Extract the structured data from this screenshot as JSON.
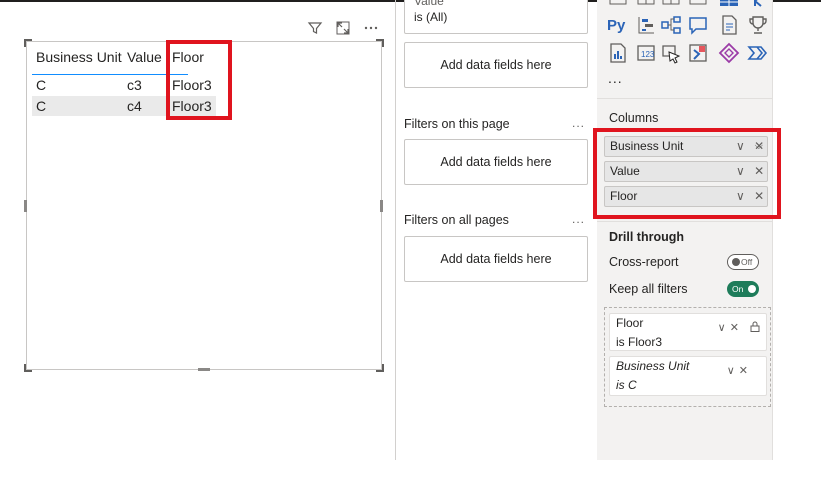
{
  "visual": {
    "table": {
      "headers": [
        "Business Unit",
        "Value",
        "Floor"
      ],
      "rows": [
        [
          "C",
          "c3",
          "Floor3"
        ],
        [
          "C",
          "c4",
          "Floor3"
        ]
      ]
    }
  },
  "filters_pane": {
    "visual_filter": {
      "field": "Value",
      "condition": "is (All)"
    },
    "add_fields_label": "Add data fields here",
    "page_filters_label": "Filters on this page",
    "all_pages_label": "Filters on all pages",
    "more_label": "..."
  },
  "viz_pane": {
    "more_label": "...",
    "columns_label": "Columns",
    "columns": [
      "Business Unit",
      "Value",
      "Floor"
    ],
    "drill_through_label": "Drill through",
    "cross_report_label": "Cross-report",
    "cross_report_state": "Off",
    "keep_filters_label": "Keep all filters",
    "keep_filters_state": "On",
    "drill_fields": [
      {
        "field": "Floor",
        "condition": "is Floor3"
      },
      {
        "field": "Business Unit",
        "condition": "is C"
      }
    ]
  },
  "colors": {
    "highlight": "#e0141e",
    "accent": "#118dff",
    "toggle_on": "#1e7c5a"
  }
}
